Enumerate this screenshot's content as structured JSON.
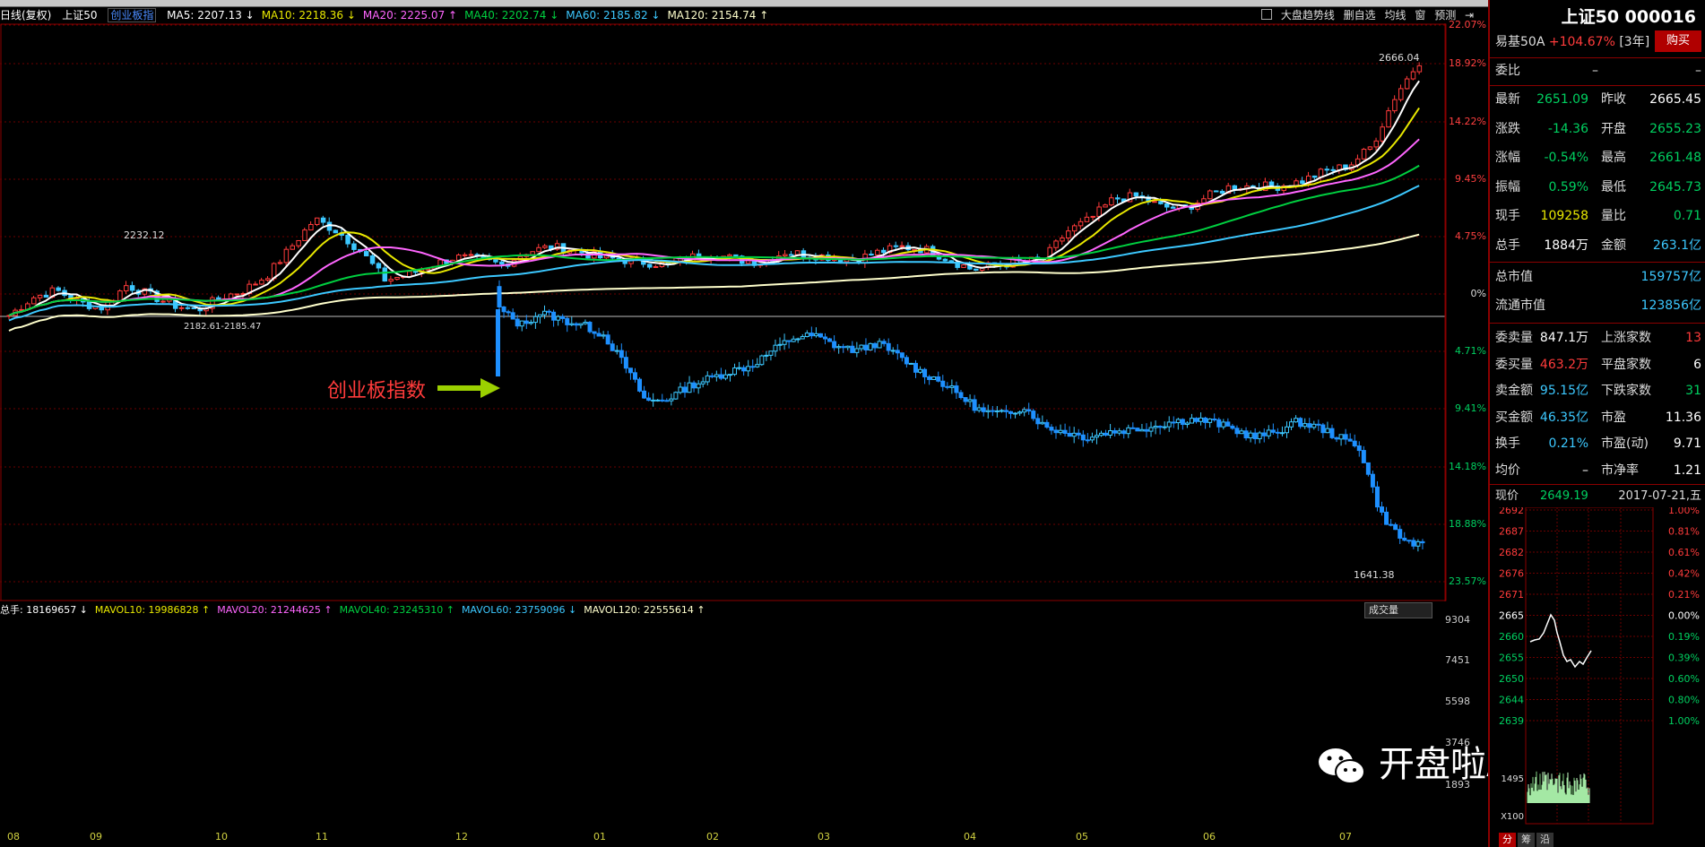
{
  "header": {
    "mode": "日线(复权)",
    "name": "上证50",
    "sub_index": "创业板指",
    "ma": [
      {
        "label": "MA5: 2207.13",
        "color": "#ffffff"
      },
      {
        "label": "MA10: 2218.36",
        "color": "#e8e800"
      },
      {
        "label": "MA20: 2225.07",
        "color": "#ff66ff"
      },
      {
        "label": "MA40: 2202.74",
        "color": "#00d040"
      },
      {
        "label": "MA60: 2185.82",
        "color": "#3cc8ff"
      },
      {
        "label": "MA120: 2154.74",
        "color": "#ffffcc"
      }
    ]
  },
  "tools": {
    "trend": "大盘趋势线",
    "self_select": "删自选",
    "ma_line": "均线",
    "window": "窗",
    "forecast": "预测"
  },
  "pct_axis_top": [
    "22.07%",
    "18.92%",
    "14.22%",
    "9.45%",
    "4.75%",
    "0%"
  ],
  "pct_axis_bottom": [
    "4.71%",
    "9.41%",
    "14.18%",
    "18.88%",
    "23.57%"
  ],
  "annotations": {
    "chinext": "创业板指数",
    "high_label": "2666.04",
    "low_label": "1641.38",
    "label_2232": "2232.12",
    "gap_label": "2182.61-2185.47"
  },
  "volume": {
    "legend": [
      {
        "label": "总手: 18169657",
        "color": "#ffffff"
      },
      {
        "label": "MAVOL10: 19986828",
        "color": "#e8e800"
      },
      {
        "label": "MAVOL20: 21244625",
        "color": "#ff66ff"
      },
      {
        "label": "MAVOL40: 23245310",
        "color": "#00d040"
      },
      {
        "label": "MAVOL60: 23759096",
        "color": "#3cc8ff"
      },
      {
        "label": "MAVOL120: 22555614",
        "color": "#ffffcc"
      }
    ],
    "selector": "成交量",
    "axis": [
      "9304",
      "7451",
      "5598",
      "3746",
      "1893"
    ]
  },
  "months": [
    "08",
    "09",
    "10",
    "11",
    "12",
    "01",
    "02",
    "03",
    "04",
    "05",
    "06",
    "07"
  ],
  "panel": {
    "title": "上证50 000016",
    "linked": "易基50A",
    "linked_change": "+104.67%",
    "linked_period": "[3年]",
    "buy": "购买",
    "webi_label": "委比",
    "webi_left": "–",
    "webi_right": "–",
    "rows": [
      {
        "l1": "最新",
        "v1": "2651.09",
        "c1": "grn",
        "l2": "昨收",
        "v2": "2665.45",
        "c2": "wht"
      },
      {
        "l1": "涨跌",
        "v1": "-14.36",
        "c1": "grn",
        "l2": "开盘",
        "v2": "2655.23",
        "c2": "grn"
      },
      {
        "l1": "涨幅",
        "v1": "-0.54%",
        "c1": "grn",
        "l2": "最高",
        "v2": "2661.48",
        "c2": "grn"
      },
      {
        "l1": "振幅",
        "v1": "0.59%",
        "c1": "grn",
        "l2": "最低",
        "v2": "2645.73",
        "c2": "grn"
      },
      {
        "l1": "现手",
        "v1": "109258",
        "c1": "yel",
        "l2": "量比",
        "v2": "0.71",
        "c2": "grn"
      },
      {
        "l1": "总手",
        "v1": "1884万",
        "c1": "wht",
        "l2": "金额",
        "v2": "263.1亿",
        "c2": "cyan"
      }
    ],
    "cap": [
      {
        "l": "总市值",
        "v": "159757亿"
      },
      {
        "l": "流通市值",
        "v": "123856亿"
      }
    ],
    "stats": [
      {
        "l1": "委卖量",
        "v1": "847.1万",
        "c1": "wht",
        "l2": "上涨家数",
        "v2": "13",
        "c2": "red"
      },
      {
        "l1": "委买量",
        "v1": "463.2万",
        "c1": "red",
        "l2": "平盘家数",
        "v2": "6",
        "c2": "wht"
      },
      {
        "l1": "卖金额",
        "v1": "95.15亿",
        "c1": "cyan",
        "l2": "下跌家数",
        "v2": "31",
        "c2": "grn"
      },
      {
        "l1": "买金额",
        "v1": "46.35亿",
        "c1": "cyan",
        "l2": "市盈",
        "v2": "11.36",
        "c2": "wht"
      },
      {
        "l1": "换手",
        "v1": "0.21%",
        "c1": "cyan",
        "l2": "市盈(动)",
        "v2": "9.71",
        "c2": "wht"
      },
      {
        "l1": "均价",
        "v1": "–",
        "c1": "wht",
        "l2": "市净率",
        "v2": "1.21",
        "c2": "wht"
      }
    ],
    "now_label": "现价",
    "now_value": "2649.19",
    "date": "2017-07-21,五",
    "mini_left": [
      "2692",
      "2687",
      "2682",
      "2676",
      "2671",
      "2665",
      "2660",
      "2655",
      "2650",
      "2644",
      "2639"
    ],
    "mini_right": [
      "1.00%",
      "0.81%",
      "0.61%",
      "0.42%",
      "0.21%",
      "0.00%",
      "0.19%",
      "0.39%",
      "0.60%",
      "0.80%",
      "1.00%"
    ],
    "mini_vol": [
      "1495",
      "X100"
    ],
    "tabs": [
      "分",
      "筹",
      "沿"
    ]
  },
  "watermark": "开盘啦App君",
  "chart_data": {
    "type": "candlestick",
    "title": "上证50 日线(复权)",
    "x_labels": [
      "08",
      "09",
      "10",
      "11",
      "12",
      "01",
      "02",
      "03",
      "04",
      "05",
      "06",
      "07"
    ],
    "main_index": {
      "name": "上证50",
      "range": [
        2110,
        2690
      ],
      "high": 2666.04,
      "markers": [
        2232.12,
        2182.61,
        2185.47
      ],
      "close": [
        2165,
        2200,
        2215,
        2190,
        2180,
        2225,
        2205,
        2185,
        2175,
        2200,
        2215,
        2245,
        2300,
        2355,
        2330,
        2290,
        2235,
        2245,
        2265,
        2280,
        2275,
        2265,
        2290,
        2300,
        2295,
        2280,
        2275,
        2270,
        2265,
        2280,
        2285,
        2275,
        2270,
        2290,
        2285,
        2280,
        2275,
        2290,
        2300,
        2295,
        2275,
        2255,
        2265,
        2270,
        2275,
        2330,
        2355,
        2395,
        2400,
        2380,
        2375,
        2400,
        2420,
        2420,
        2420,
        2430,
        2450,
        2460,
        2500,
        2600,
        2666
      ]
    },
    "sub_index": {
      "name": "创业板指数",
      "pct_range": [
        4.71,
        23.57
      ],
      "low": 1641.38,
      "close": [
        2132,
        2100,
        2125,
        2110,
        2100,
        2080,
        2020,
        1950,
        1955,
        1980,
        1995,
        2010,
        2020,
        2050,
        2075,
        2080,
        2060,
        2050,
        2065,
        2040,
        2010,
        1990,
        1960,
        1930,
        1925,
        1940,
        1900,
        1890,
        1880,
        1890,
        1895,
        1900,
        1910,
        1915,
        1910,
        1895,
        1880,
        1890,
        1910,
        1900,
        1880,
        1860,
        1730,
        1680,
        1665
      ]
    },
    "volume": {
      "axis": [
        1893,
        3746,
        5598,
        7451,
        9304
      ],
      "unit": "x100"
    }
  }
}
